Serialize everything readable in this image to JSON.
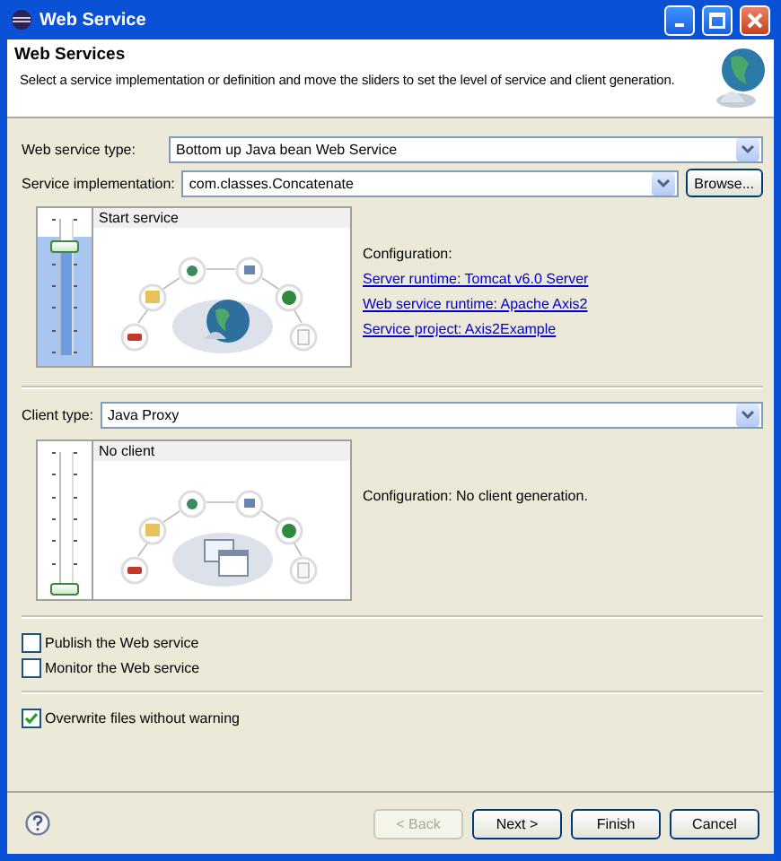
{
  "window": {
    "title": "Web Service"
  },
  "header": {
    "title": "Web Services",
    "description": "Select a service implementation or definition and move the sliders to set the level of service and client generation."
  },
  "service_type": {
    "label": "Web service type:",
    "value": "Bottom up Java bean Web Service"
  },
  "service_implementation": {
    "label": "Service implementation:",
    "value": "com.classes.Concatenate",
    "button": "Browse..."
  },
  "service_panel": {
    "kind": "service",
    "level": 0.83,
    "caption": "Start service",
    "configuration": "Configuration:",
    "links": [
      "Server runtime: Tomcat v6.0 Server",
      "Web service runtime: Apache Axis2",
      "Service project: Axis2Example"
    ]
  },
  "client_type": {
    "label": "Client type:",
    "value": "Java Proxy"
  },
  "client_panel": {
    "kind": "client",
    "level": 0,
    "caption": "No client",
    "configuration": "Configuration: No client generation."
  },
  "options": [
    {
      "label": "Publish the Web service",
      "checked": false
    },
    {
      "label": "Monitor the Web service",
      "checked": false
    }
  ],
  "overwrite": {
    "label": "Overwrite files without warning",
    "checked": true
  },
  "buttons": [
    {
      "label": "< Back",
      "disabled": true
    },
    {
      "label": "Next >",
      "disabled": false
    },
    {
      "label": "Finish",
      "disabled": false
    },
    {
      "label": "Cancel",
      "disabled": false
    }
  ]
}
